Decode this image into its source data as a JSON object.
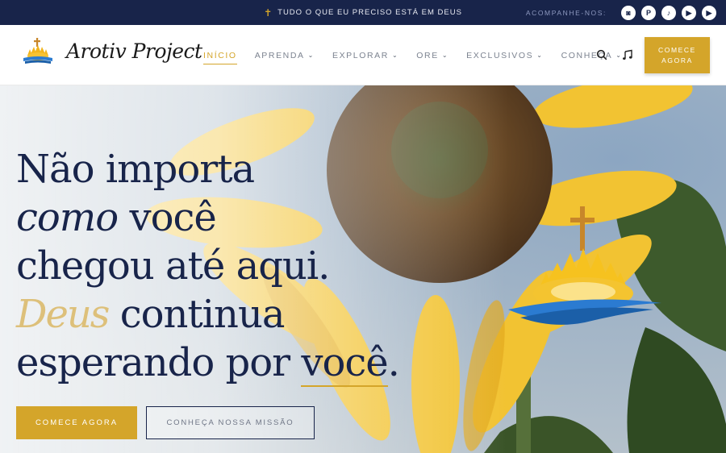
{
  "topbar": {
    "message": "TUDO O QUE EU PRECISO ESTÁ EM DEUS",
    "follow_label": "ACOMPANHE-NOS:",
    "socials": [
      {
        "name": "instagram-icon",
        "glyph": "◙"
      },
      {
        "name": "pinterest-icon",
        "glyph": "P"
      },
      {
        "name": "tiktok-icon",
        "glyph": "♪"
      },
      {
        "name": "youtube-icon",
        "glyph": "▶"
      },
      {
        "name": "youtube-icon",
        "glyph": "▶"
      }
    ]
  },
  "header": {
    "brand": "Arotiv Project",
    "nav": [
      {
        "label": "INÍCIO",
        "active": true,
        "has_dropdown": false
      },
      {
        "label": "APRENDA",
        "active": false,
        "has_dropdown": true
      },
      {
        "label": "EXPLORAR",
        "active": false,
        "has_dropdown": true
      },
      {
        "label": "ORE",
        "active": false,
        "has_dropdown": true
      },
      {
        "label": "EXCLUSIVOS",
        "active": false,
        "has_dropdown": true
      },
      {
        "label": "CONHEÇA",
        "active": false,
        "has_dropdown": true
      }
    ],
    "search_icon": "search-icon",
    "music_icon": "music-note-icon",
    "cta_line1": "COMECE",
    "cta_line2": "AGORA"
  },
  "hero": {
    "line1": "Não importa",
    "line2_italic": "como",
    "line2_rest": " você",
    "line3": "chegou até aqui.",
    "line4_script": "Deus",
    "line4_rest": " continua",
    "line5_start": "esperando por ",
    "line5_underlined": "você",
    "line5_end": ".",
    "primary_button": "COMECE AGORA",
    "secondary_button": "CONHEÇA NOSSA MISSÃO"
  },
  "colors": {
    "navy": "#18244a",
    "gold": "#d4a52a",
    "accent_blue": "#2b7bd1"
  }
}
